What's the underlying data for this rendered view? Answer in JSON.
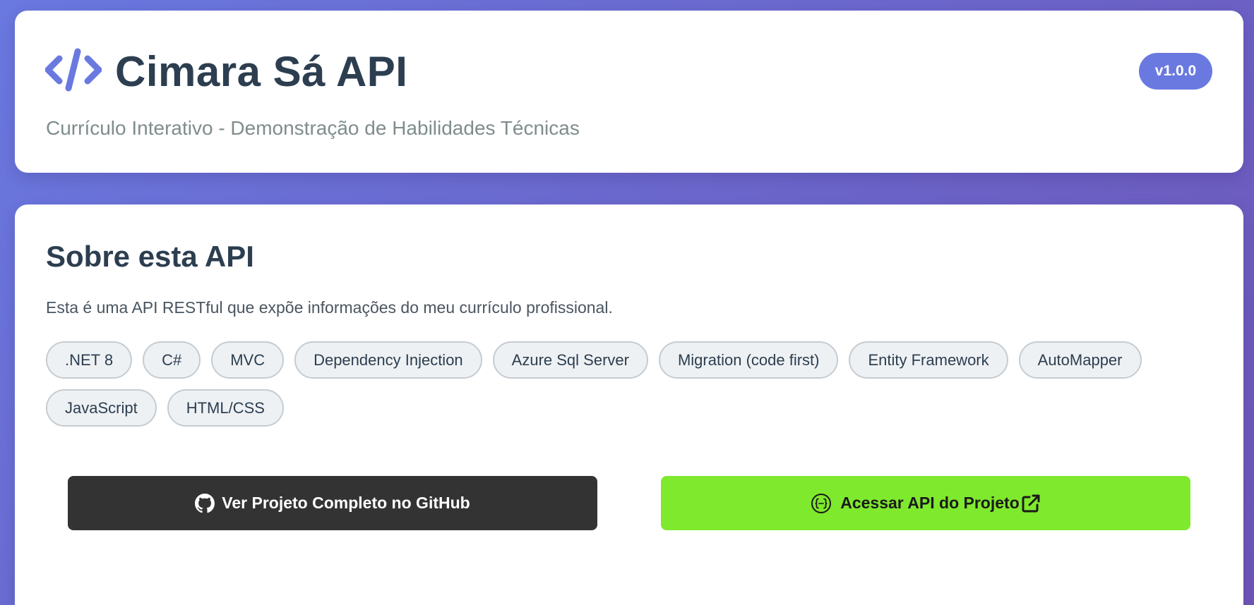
{
  "header": {
    "title": "Cimara Sá API",
    "subtitle": "Currículo Interativo - Demonstração de Habilidades Técnicas",
    "version": "v1.0.0",
    "logo_icon": "code-icon",
    "accent_color": "#6a79e0"
  },
  "about": {
    "title": "Sobre esta API",
    "description": "Esta é uma API RESTful que expõe informações do meu currículo profissional.",
    "tags": [
      ".NET 8",
      "C#",
      "MVC",
      "Dependency Injection",
      "Azure Sql Server",
      "Migration (code first)",
      "Entity Framework",
      "AutoMapper",
      "JavaScript",
      "HTML/CSS"
    ]
  },
  "actions": {
    "github_label": "Ver Projeto Completo no GitHub",
    "github_icon": "github-icon",
    "github_color": "#333333",
    "api_label": "Acessar API do Projeto",
    "api_icon": "api-braces-icon",
    "api_external_icon": "external-link-icon",
    "api_color": "#7fe92e"
  }
}
